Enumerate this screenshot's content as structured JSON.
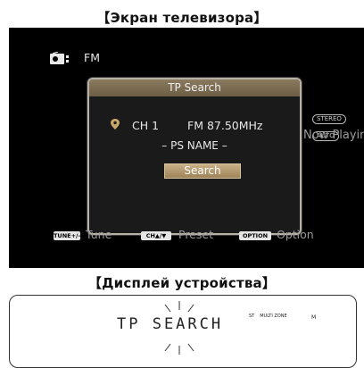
{
  "captions": {
    "tv_screen": "【Экран телевизора】",
    "device_display": "【Дисплей устройства】"
  },
  "tv": {
    "source_icon": "radio-icon",
    "source_label": "FM",
    "mode_badges": [
      "STEREO",
      "AUTO"
    ],
    "now_playing": "Now Playing",
    "dialog": {
      "title": "TP Search",
      "channel": "CH 1",
      "frequency": "FM 87.50MHz",
      "ps_name": "– PS NAME –",
      "search_button": "Search"
    },
    "footer": {
      "tune_key": "TUNE+/–",
      "tune_label": "Tune",
      "preset_key": "CH▲/▼",
      "preset_label": "Preset",
      "option_key": "OPTION",
      "option_label": "Option"
    }
  },
  "device": {
    "text": "TP SEARCH",
    "indicators": [
      "ST",
      "MULTI ZONE"
    ],
    "marker": "M"
  },
  "colors": {
    "tv_background": "#000000",
    "dialog_title_bar": "#7a6b50",
    "search_button": "#b59a6e",
    "text": "#e8e8e8"
  }
}
